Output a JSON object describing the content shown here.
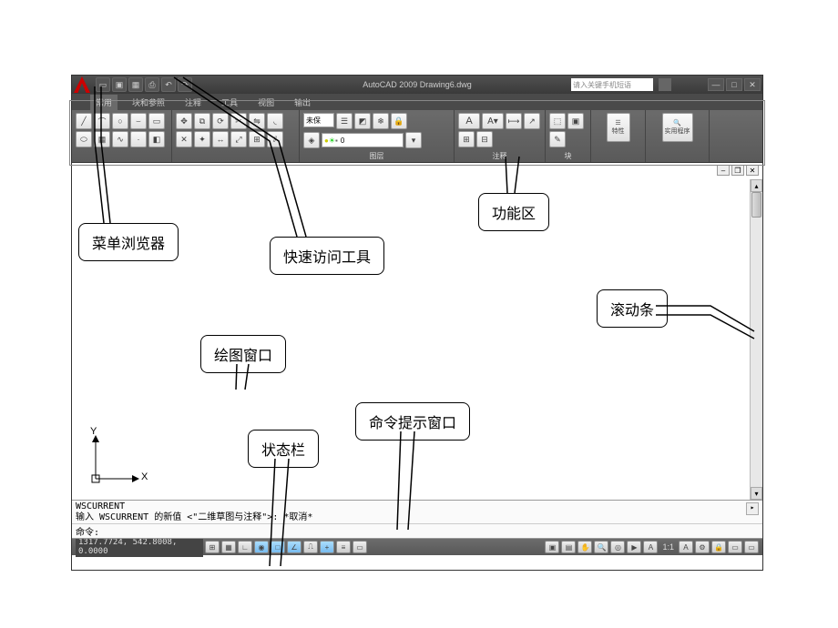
{
  "window": {
    "title": "AutoCAD 2009 Drawing6.dwg",
    "search_placeholder": "请入关键手机短语"
  },
  "menubar": {
    "items": [
      "常用",
      "块和参照",
      "注释",
      "工具",
      "视图",
      "输出"
    ]
  },
  "ribbon": {
    "unsaved_label": "未保",
    "layer_label": "0",
    "panel_labels": {
      "layers": "图层",
      "annotation": "注释",
      "block": "块",
      "properties": "特性",
      "utilities": "实用程序"
    }
  },
  "ucs": {
    "x": "X",
    "y": "Y"
  },
  "command": {
    "line1": "WSCURRENT",
    "line2": "输入 WSCURRENT 的新值 <\"二维草图与注释\">: *取消*",
    "prompt": "命令:"
  },
  "status": {
    "coords": "1317.7724, 542.8008, 0.0000",
    "scale": "1:1"
  },
  "callouts": {
    "menu_browser": "菜单浏览器",
    "qat": "快速访问工具",
    "ribbon": "功能区",
    "scrollbar": "滚动条",
    "drawing_window": "绘图窗口",
    "status_bar": "状态栏",
    "command_window": "命令提示窗口"
  }
}
